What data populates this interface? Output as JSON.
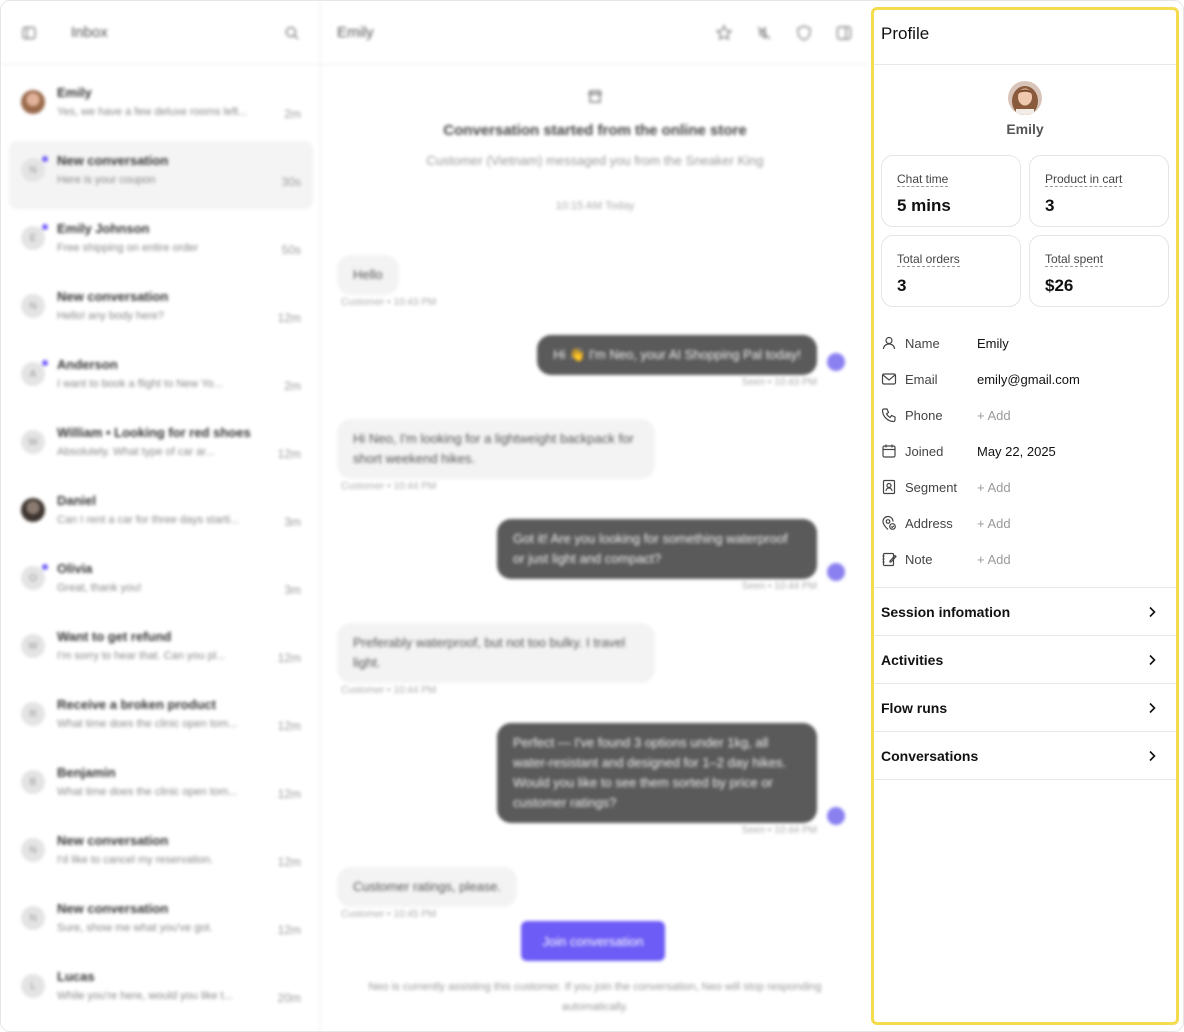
{
  "inbox": {
    "title": "Inbox",
    "conversations": [
      {
        "name": "Emily",
        "preview": "Yes, we have a few deluxe rooms left...",
        "time": "2m",
        "avatar": "photo",
        "unread": false,
        "active": false
      },
      {
        "name": "New conversation",
        "preview": "Here is your coupon",
        "time": "30s",
        "avatar": "N",
        "unread": true,
        "active": true
      },
      {
        "name": "Emily Johnson",
        "preview": "Free shipping on entire order",
        "time": "50s",
        "avatar": "E",
        "unread": true,
        "active": false
      },
      {
        "name": "New conversation",
        "preview": "Hello! any body here?",
        "time": "12m",
        "avatar": "N",
        "unread": false,
        "active": false
      },
      {
        "name": "Anderson",
        "preview": "I want to book a flight to New Yo...",
        "time": "2m",
        "avatar": "A",
        "unread": true,
        "active": false
      },
      {
        "name": "William • Looking for red shoes",
        "preview": "Absolutely. What type of car ar...",
        "time": "12m",
        "avatar": "W",
        "unread": false,
        "active": false
      },
      {
        "name": "Daniel",
        "preview": "Can I rent a car for three days starti...",
        "time": "3m",
        "avatar": "dark",
        "unread": false,
        "active": false
      },
      {
        "name": "Olivia",
        "preview": "Great, thank you!",
        "time": "3m",
        "avatar": "O",
        "unread": true,
        "active": false
      },
      {
        "name": "Want to get refund",
        "preview": "I'm sorry to hear that. Can you pl...",
        "time": "12m",
        "avatar": "W",
        "unread": false,
        "active": false
      },
      {
        "name": "Receive a broken product",
        "preview": "What time does the clinic open tom...",
        "time": "12m",
        "avatar": "R",
        "unread": false,
        "active": false
      },
      {
        "name": "Benjamin",
        "preview": "What time does the clinic open tom...",
        "time": "12m",
        "avatar": "B",
        "unread": false,
        "active": false
      },
      {
        "name": "New conversation",
        "preview": "I'd like to cancel my reservation.",
        "time": "12m",
        "avatar": "N",
        "unread": false,
        "active": false
      },
      {
        "name": "New conversation",
        "preview": "Sure, show me what you've got.",
        "time": "12m",
        "avatar": "N",
        "unread": false,
        "active": false
      },
      {
        "name": "Lucas",
        "preview": "While you're here, would you like t...",
        "time": "20m",
        "avatar": "L",
        "unread": false,
        "active": false
      }
    ]
  },
  "chat": {
    "title": "Emily",
    "started_title": "Conversation started from the online store",
    "started_sub": "Customer (Vietnam) messaged you from the Sneaker King",
    "date_label": "10:15 AM Today",
    "messages": [
      {
        "dir": "in",
        "text": "Hello",
        "meta": "Customer • 10:43 PM"
      },
      {
        "dir": "out",
        "text": "Hi 👋 I'm Neo, your AI Shopping Pal today!",
        "meta": "Seen • 10:43 PM"
      },
      {
        "dir": "in",
        "text": "Hi Neo, I'm looking for a lightweight backpack for short weekend hikes.",
        "meta": "Customer • 10:44 PM"
      },
      {
        "dir": "out",
        "text": "Got it! Are you looking for something waterproof or just light and compact?",
        "meta": "Seen • 10:44 PM"
      },
      {
        "dir": "in",
        "text": "Preferably waterproof, but not too bulky. I travel light.",
        "meta": "Customer • 10:44 PM"
      },
      {
        "dir": "out",
        "text": "Perfect — I've found 3 options under 1kg, all water-resistant and designed for 1–2 day hikes. Would you like to see them sorted by price or customer ratings?",
        "meta": "Seen • 10:44 PM"
      },
      {
        "dir": "in",
        "text": "Customer ratings, please.",
        "meta": "Customer • 10:45 PM"
      }
    ],
    "join_label": "Join conversation",
    "notice": "Neo is currently assisting this customer. If you join the conversation, Neo will stop responding automatically."
  },
  "profile": {
    "title": "Profile",
    "name": "Emily",
    "stats": [
      {
        "label": "Chat time",
        "value": "5 mins"
      },
      {
        "label": "Product in cart",
        "value": "3"
      },
      {
        "label": "Total orders",
        "value": "3"
      },
      {
        "label": "Total spent",
        "value": "$26"
      }
    ],
    "fields": [
      {
        "icon": "user-icon",
        "label": "Name",
        "value": "Emily",
        "empty": false
      },
      {
        "icon": "mail-icon",
        "label": "Email",
        "value": "emily@gmail.com",
        "empty": false
      },
      {
        "icon": "phone-icon",
        "label": "Phone",
        "value": "+ Add",
        "empty": true
      },
      {
        "icon": "calendar-icon",
        "label": "Joined",
        "value": "May 22, 2025",
        "empty": false
      },
      {
        "icon": "contact-book-icon",
        "label": "Segment",
        "value": "+ Add",
        "empty": true
      },
      {
        "icon": "location-icon",
        "label": "Address",
        "value": "+ Add",
        "empty": true
      },
      {
        "icon": "note-icon",
        "label": "Note",
        "value": "+ Add",
        "empty": true
      }
    ],
    "sections": [
      "Session infomation",
      "Activities",
      "Flow runs",
      "Conversations"
    ]
  },
  "colors": {
    "accent": "#6d5cf6",
    "highlight_border": "#f5dc4f",
    "bubble_out": "#5a5a5a"
  }
}
